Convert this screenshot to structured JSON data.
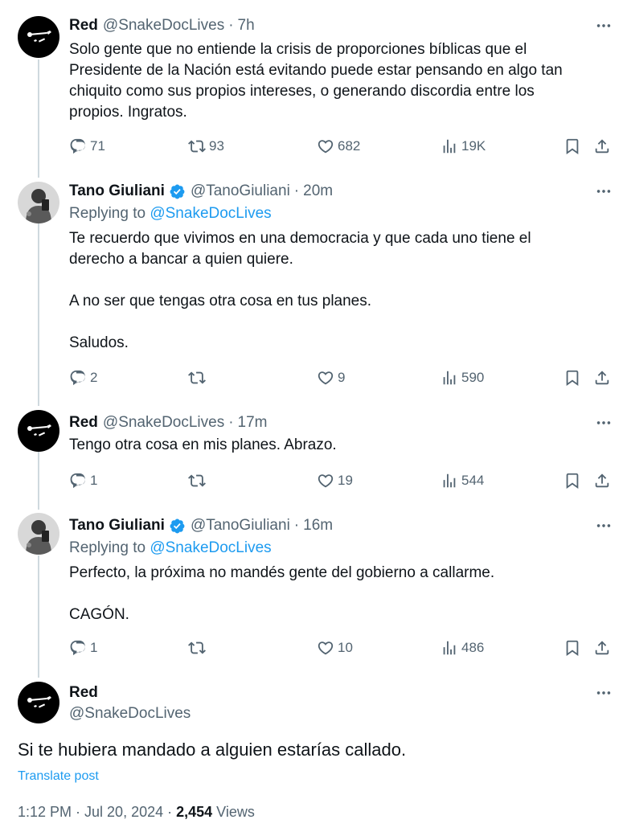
{
  "tweets": [
    {
      "name": "Red",
      "handle": "@SnakeDocLives",
      "time": "7h",
      "text": "Solo gente que no entiende la crisis de proporciones bíblicas que el\nPresidente de la Nación está evitando puede estar pensando en algo tan\nchiquito como sus propios intereses, o generando discordia entre los\npropios. Ingratos.",
      "replies": "71",
      "retweets": "93",
      "likes": "682",
      "views": "19K"
    },
    {
      "name": "Tano Giuliani",
      "handle": "@TanoGiuliani",
      "time": "20m",
      "replying_prefix": "Replying to",
      "replying_to": "@SnakeDocLives",
      "text": "Te recuerdo que vivimos en una democracia y que cada uno tiene el\nderecho a bancar a quien quiere.\n\nA no ser que tengas otra cosa en tus planes.\n\nSaludos.",
      "replies": "2",
      "retweets": "",
      "likes": "9",
      "views": "590"
    },
    {
      "name": "Red",
      "handle": "@SnakeDocLives",
      "time": "17m",
      "text": "Tengo otra cosa en mis planes. Abrazo.",
      "replies": "1",
      "retweets": "",
      "likes": "19",
      "views": "544"
    },
    {
      "name": "Tano Giuliani",
      "handle": "@TanoGiuliani",
      "time": "16m",
      "replying_prefix": "Replying to",
      "replying_to": "@SnakeDocLives",
      "text": "Perfecto, la próxima no mandés gente del gobierno a callarme.\n\nCAGÓN.",
      "replies": "1",
      "retweets": "",
      "likes": "10",
      "views": "486"
    }
  ],
  "main_tweet": {
    "name": "Red",
    "handle": "@SnakeDocLives",
    "text": "Si te hubiera mandado a alguien estarías callado.",
    "translate": "Translate post",
    "timestamp": "1:12 PM · Jul 20, 2024 · ",
    "views_count": "2,454",
    "views_label": "Views"
  },
  "separator": "·",
  "icons": {
    "reply": "reply-icon",
    "retweet": "retweet-icon",
    "like": "heart-icon",
    "views": "views-icon",
    "bookmark": "bookmark-icon",
    "share": "share-icon",
    "more": "more-icon",
    "verified": "verified-badge-icon"
  },
  "colors": {
    "link": "#1d9bf0",
    "secondary": "#536471",
    "primary_text": "#0f1419"
  }
}
